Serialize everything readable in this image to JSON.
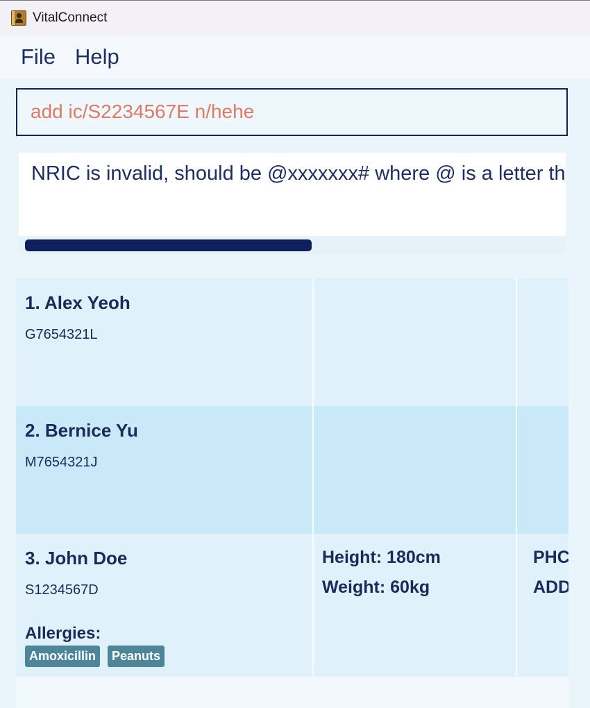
{
  "window": {
    "title": "VitalConnect",
    "icon": "address-book-icon"
  },
  "menu": {
    "items": [
      "File",
      "Help"
    ]
  },
  "command": {
    "value": "add ic/S2234567E n/hehe"
  },
  "result": {
    "text": "NRIC is invalid, should be @xxxxxxx# where @ is a letter that"
  },
  "colors": {
    "accent": "#0d1f5c",
    "command_text": "#e07a64",
    "row_odd": "#e0f1f9",
    "row_even": "#c8e9f7",
    "tag": "#4d8699"
  },
  "persons": [
    {
      "name": "1. Alex Yeoh",
      "nric": "G7654321L"
    },
    {
      "name": "2. Bernice Yu",
      "nric": "M7654321J"
    },
    {
      "name": "3. John Doe",
      "nric": "S1234567D",
      "height": "Height: 180cm",
      "weight": "Weight: 60kg",
      "col3_line1": "PHC",
      "col3_line2": "ADD",
      "allergies_label": "Allergies:",
      "allergies": [
        "Amoxicillin",
        "Peanuts"
      ]
    }
  ]
}
